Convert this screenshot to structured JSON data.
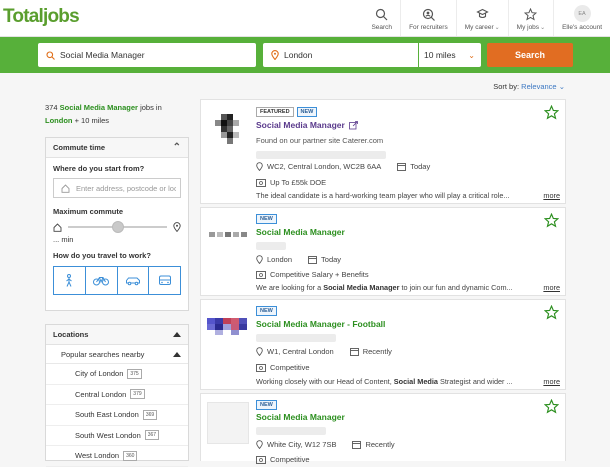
{
  "brand": {
    "name": "Totaljobs",
    "color": "#5a9e2e"
  },
  "nav": [
    {
      "label": "Search",
      "icon": "search-icon"
    },
    {
      "label": "For recruiters",
      "icon": "recruiter-search-icon"
    },
    {
      "label": "My career",
      "icon": "career-icon",
      "chevron": true
    },
    {
      "label": "My jobs",
      "icon": "star-icon",
      "chevron": true
    },
    {
      "label": "Elle's account",
      "avatar": "EA"
    }
  ],
  "search": {
    "keyword": "Social Media Manager",
    "location": "London",
    "distance": "10 miles",
    "button": "Search"
  },
  "sort": {
    "label": "Sort by:",
    "value": "Relevance"
  },
  "results": {
    "count": "374",
    "keyword": "Social Media Manager",
    "mid": "jobs in",
    "location": "London",
    "radius": "+ 10 miles"
  },
  "commute": {
    "title": "Commute time",
    "start_question": "Where do you start from?",
    "postcode_placeholder": "Enter address, postcode or location",
    "max_label": "Maximum commute",
    "min_label": "... min",
    "travel_question": "How do you travel to work?",
    "slider_fraction": 0.5,
    "modes": [
      "walking-icon",
      "bicycle-icon",
      "car-icon",
      "bus-icon"
    ]
  },
  "locations": {
    "title": "Locations",
    "popular": "Popular searches nearby",
    "items": [
      {
        "name": "City of London",
        "count": "375"
      },
      {
        "name": "Central London",
        "count": "379"
      },
      {
        "name": "South East London",
        "count": "369"
      },
      {
        "name": "South West London",
        "count": "367"
      },
      {
        "name": "West London",
        "count": "360"
      }
    ]
  },
  "jobs": [
    {
      "tags": [
        "FEATURED",
        "NEW"
      ],
      "title": "Social Media Manager",
      "partner": "Found on our partner site Caterer.com",
      "location": "WC2, Central London, WC2B 6AA",
      "posted": "Today",
      "salary": "Up To £55k DOE",
      "desc_pre": "The ideal candidate is a hard-working team player who will play a critical role...",
      "desc_bold": "",
      "desc_post": "",
      "more": "more"
    },
    {
      "tags": [
        "NEW"
      ],
      "title": "Social Media Manager",
      "location": "London",
      "posted": "Today",
      "salary": "Competitive Salary + Benefits",
      "desc_pre": "We are looking for a ",
      "desc_bold": "Social Media Manager",
      "desc_post": " to join our fun and dynamic Com...",
      "more": "more"
    },
    {
      "tags": [
        "NEW"
      ],
      "title": "Social Media Manager - Football",
      "location": "W1, Central London",
      "posted": "Recently",
      "salary": "Competitive",
      "desc_pre": "Working closely with our Head of Content, ",
      "desc_bold": "Social Media",
      "desc_post": " Strategist and wider ...",
      "more": "more"
    },
    {
      "tags": [
        "NEW"
      ],
      "title": "Social Media Manager",
      "location": "White City, W12 7SB",
      "posted": "Recently",
      "salary": "Competitive"
    }
  ]
}
